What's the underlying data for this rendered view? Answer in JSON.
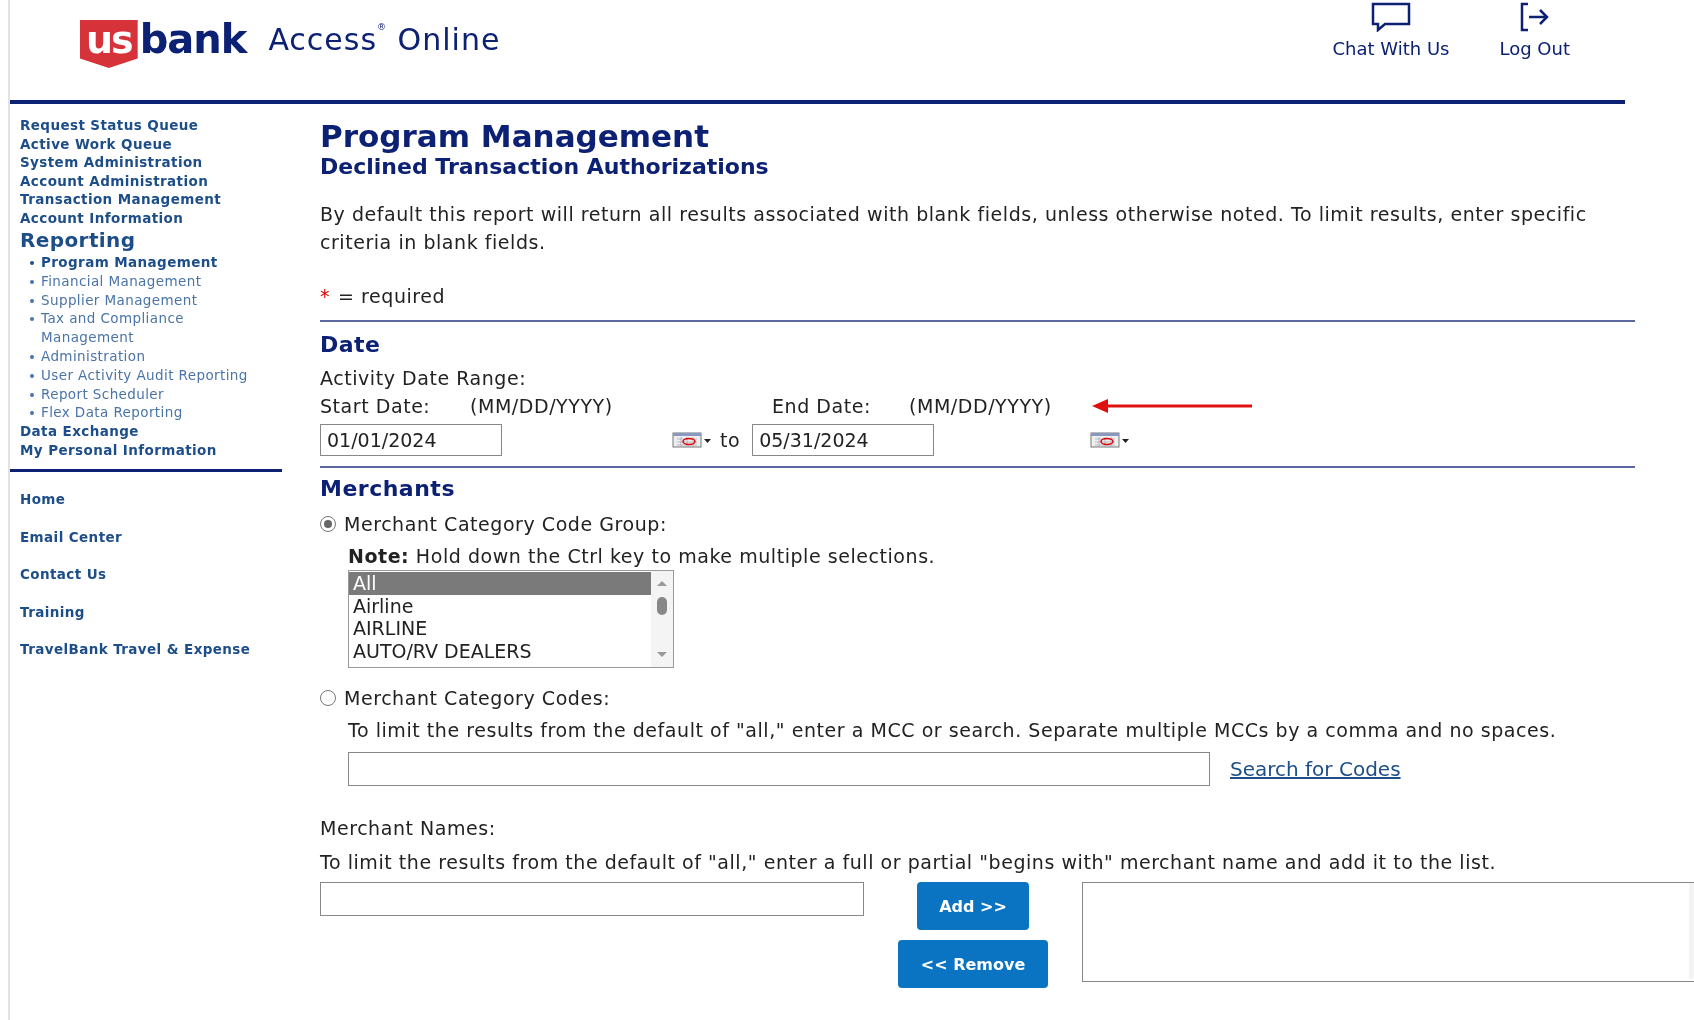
{
  "header": {
    "logo": {
      "mark": "us",
      "word": "bank"
    },
    "product": "Access$^{®}$ Online",
    "actions": [
      {
        "kind": "chat",
        "label": "Chat With Us"
      },
      {
        "kind": "logout",
        "label": "Log Out"
      }
    ]
  },
  "sidebar": {
    "items": [
      {
        "label": "Request Status Queue",
        "selected": false
      },
      {
        "label": "Active Work Queue",
        "selected": false
      },
      {
        "label": "System Administration",
        "selected": false
      },
      {
        "label": "Account Administration",
        "selected": false
      },
      {
        "label": "Transaction Management",
        "selected": false
      },
      {
        "label": "Account Information",
        "selected": false
      },
      {
        "label": "Reporting",
        "selected": false,
        "children": [
          {
            "label": "Program Management",
            "selected": true
          },
          {
            "label": "Financial Management",
            "selected": false
          },
          {
            "label": "Supplier Management",
            "selected": false
          },
          {
            "label": "Tax and Compliance Management",
            "selected": false
          },
          {
            "label": "Administration",
            "selected": false
          },
          {
            "label": "User Activity Audit Reporting",
            "selected": false
          },
          {
            "label": "Report Scheduler",
            "selected": false
          },
          {
            "label": "Flex Data Reporting",
            "selected": false
          }
        ]
      },
      {
        "label": "Data Exchange",
        "selected": false
      },
      {
        "label": "My Personal Information",
        "selected": false
      }
    ],
    "links": [
      "Home",
      "Email Center",
      "Contact Us",
      "Training",
      "TravelBank Travel & Expense"
    ]
  },
  "page": {
    "title": "Program Management",
    "subtitle": "Declined Transaction Authorizations",
    "intro": "By default this report will return all results associated with blank fields, unless otherwise noted. To limit results, enter specific criteria in blank fields.",
    "required_mark": "*",
    "required_note": "= required"
  },
  "date_section": {
    "heading": "Date",
    "range_label": "Activity Date Range:",
    "start_label": "Start Date:",
    "start_format": "(MM/DD/YYYY)",
    "end_label": "End Date:",
    "end_format": "(MM/DD/YYYY)",
    "start_value": "01/01/2024",
    "to": "to",
    "end_value": "05/31/2024"
  },
  "merchants": {
    "heading": "Merchants",
    "group_option": {
      "label": "Merchant Category Code Group:",
      "selected": true
    },
    "note_label": "Note:",
    "note": "Hold down the Ctrl key to make multiple selections.",
    "groups": [
      {
        "label": "All",
        "selected": true
      },
      {
        "label": "Airline",
        "selected": false
      },
      {
        "label": "AIRLINE",
        "selected": false
      },
      {
        "label": "AUTO/RV DEALERS",
        "selected": false
      }
    ],
    "codes_option": {
      "label": "Merchant Category Codes:",
      "selected": false
    },
    "codes_help": "To limit the results from the default of \"all,\" enter a MCC or search. Separate multiple MCCs by a comma and no spaces.",
    "search_link": "Search for Codes",
    "names_label": "Merchant Names:",
    "names_help": "To limit the results from the default of \"all,\" enter a full or partial \"begins with\" merchant name and add it to the list.",
    "add_button": "Add >>",
    "remove_button": "<< Remove"
  }
}
